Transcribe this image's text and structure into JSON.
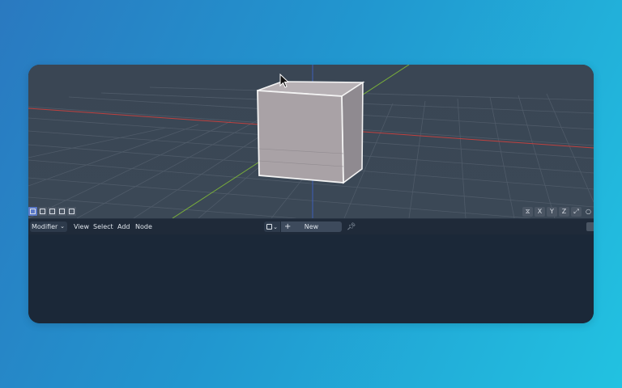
{
  "viewport": {
    "axis_labels": [
      "X",
      "Y",
      "Z"
    ],
    "colors": {
      "background": "#3a4654",
      "grid": "#4e5a68",
      "x_axis": "#c0413f",
      "y_axis": "#7ab03a",
      "z_axis": "#3e5fb8",
      "cube_face": "#a9a2a6",
      "cube_outline": "#f4f4f4"
    }
  },
  "node_editor": {
    "editor_type": "Modifier",
    "menus": [
      "View",
      "Select",
      "Add",
      "Node"
    ],
    "new_button": "New",
    "background": "#1b2838"
  }
}
